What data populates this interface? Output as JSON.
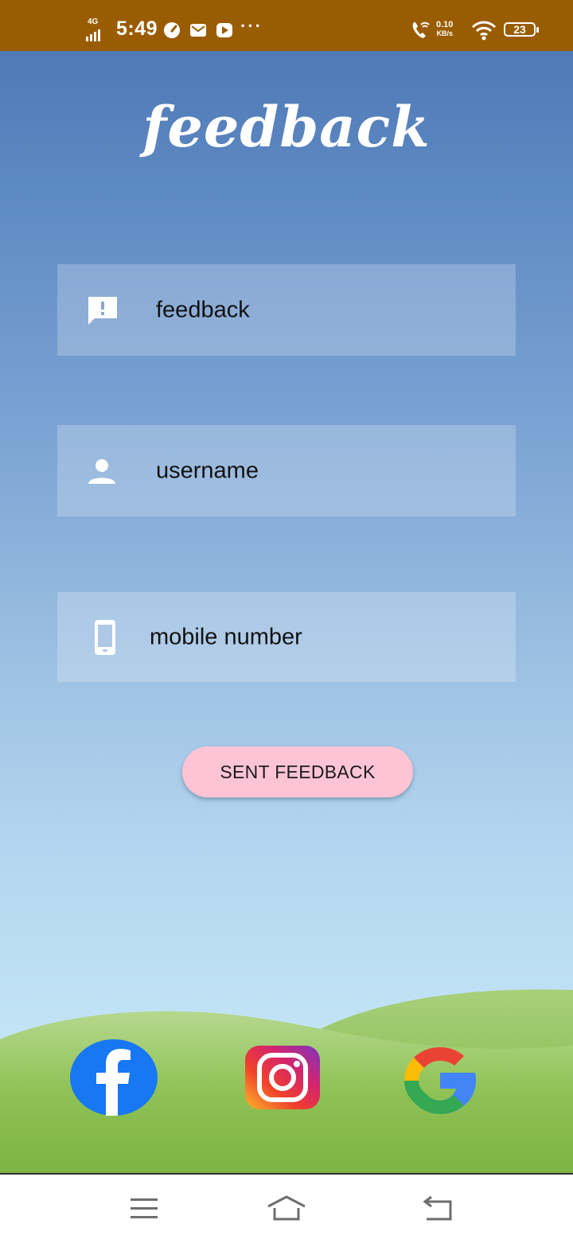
{
  "status_bar": {
    "network": "4G",
    "time": "5:49",
    "speed_value": "0.10",
    "speed_unit": "KB/s",
    "battery": "23",
    "icons": [
      "signal-icon",
      "speedometer-icon",
      "mail-icon",
      "youtube-icon",
      "more-dots-icon",
      "wifi-call-icon",
      "wifi-icon",
      "battery-icon"
    ]
  },
  "page": {
    "title": "feedback"
  },
  "form": {
    "feedback_placeholder": "feedback",
    "username_placeholder": "username",
    "mobile_placeholder": "mobile number",
    "submit_label": "SENT FEEDBACK"
  },
  "social": {
    "icons": [
      "facebook-icon",
      "instagram-icon",
      "google-icon"
    ]
  },
  "navbar": {
    "icons": [
      "menu-icon",
      "home-icon",
      "back-icon"
    ]
  },
  "colors": {
    "status_bar": "#9a5c00",
    "sky_top": "#4f79b7",
    "sky_bottom": "#c6e6f4",
    "button": "#fdc4d6",
    "grass": "#7cb342"
  }
}
